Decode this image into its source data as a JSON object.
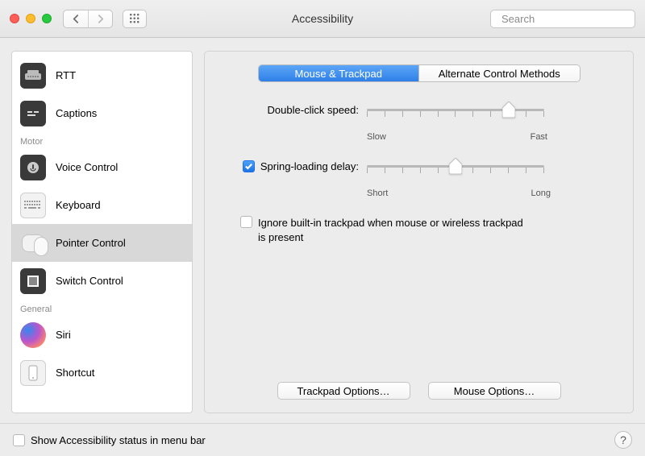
{
  "window": {
    "title": "Accessibility"
  },
  "search": {
    "placeholder": "Search"
  },
  "sidebar": {
    "groups": [
      {
        "name": "Hearing_visible_items",
        "items": [
          {
            "label": "RTT"
          },
          {
            "label": "Captions"
          }
        ]
      },
      {
        "name": "Motor",
        "header": "Motor",
        "items": [
          {
            "label": "Voice Control"
          },
          {
            "label": "Keyboard"
          },
          {
            "label": "Pointer Control",
            "selected": true
          },
          {
            "label": "Switch Control"
          }
        ]
      },
      {
        "name": "General",
        "header": "General",
        "items": [
          {
            "label": "Siri"
          },
          {
            "label": "Shortcut"
          }
        ]
      }
    ]
  },
  "tabs": {
    "items": [
      {
        "label": "Mouse & Trackpad",
        "active": true
      },
      {
        "label": "Alternate Control Methods",
        "active": false
      }
    ]
  },
  "settings": {
    "double_click": {
      "label": "Double-click speed:",
      "min_label": "Slow",
      "max_label": "Fast",
      "ticks": 11,
      "value_index": 8
    },
    "spring_loading": {
      "checked": true,
      "label": "Spring-loading delay:",
      "min_label": "Short",
      "max_label": "Long",
      "ticks": 11,
      "value_index": 5
    },
    "ignore_trackpad": {
      "checked": false,
      "label": "Ignore built-in trackpad when mouse or wireless trackpad is present"
    }
  },
  "buttons": {
    "trackpad_options": "Trackpad Options…",
    "mouse_options": "Mouse Options…"
  },
  "footer": {
    "show_menu_bar": {
      "checked": false,
      "label": "Show Accessibility status in menu bar"
    },
    "help": "?"
  }
}
